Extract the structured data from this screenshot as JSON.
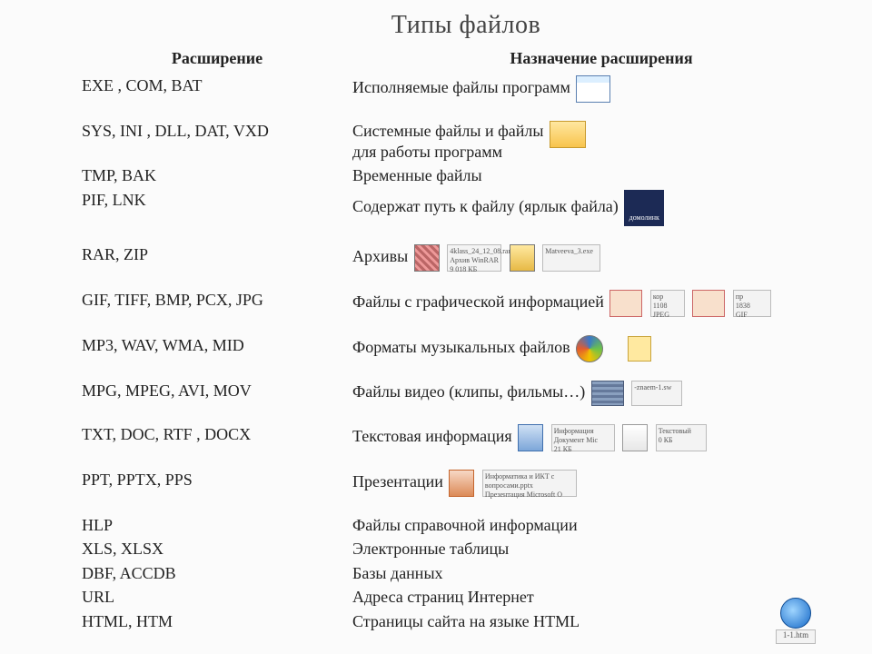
{
  "title": "Типы файлов",
  "headers": {
    "ext": "Расширение",
    "desc": "Назначение расширения"
  },
  "rows": [
    {
      "ext": "EXE ,  COM,     BAT",
      "desc": "Исполняемые файлы программ"
    },
    {
      "ext": "SYS,   INI ,   DLL, DAT, VXD",
      "desc": "Системные файлы и файлы\nдля работы программ"
    },
    {
      "ext": "TMP,    BAK",
      "desc": "Временные файлы"
    },
    {
      "ext": "PIF, LNK",
      "desc": "Содержат путь к файлу (ярлык файла)"
    },
    {
      "ext": "RAR,   ZIP",
      "desc": "Архивы"
    },
    {
      "ext": "GIF, TIFF,   BMP,   PCX,   JPG",
      "desc": "Файлы с графической информацией"
    },
    {
      "ext": "MP3,   WAV,  WMA,  MID",
      "desc": "Форматы музыкальных файлов"
    },
    {
      "ext": "MPG,   MPEG,   AVI, MOV",
      "desc": "Файлы видео (клипы, фильмы…)"
    },
    {
      "ext": "TXT,   DOC,  RTF ,  DOCX",
      "desc": "Текстовая информация"
    },
    {
      "ext": "PPT,   PPTX,   PPS",
      "desc": "Презентации"
    },
    {
      "ext": "HLP",
      "desc": "Файлы справочной информации"
    },
    {
      "ext": "XLS,  XLSX",
      "desc": "Электронные таблицы"
    },
    {
      "ext": "DBF, ACCDB",
      "desc": "Базы данных"
    },
    {
      "ext": "URL",
      "desc": "Адреса страниц Интернет"
    },
    {
      "ext": "HTML,  HTM",
      "desc": "Страницы сайта на языке HTML"
    }
  ],
  "thumb_labels": {
    "desklink": "домолинк",
    "rar": "4klass_24_12_08.rar\nАрхив WinRAR\n9 018 КБ",
    "zip": "Matveeva_3.exe",
    "img1": "кор\n1108\nJPEG",
    "img2": "пр\n1838\nGIF",
    "mov": "-znaem-1.sw",
    "doc": "Информация\nДокумент Mic\n21 КБ",
    "txt": "Текстовый\n0 КБ",
    "ppt": "Информатика и ИКТ с\nвопросами.pptx\nПрезентация Microsoft O",
    "ie": "1-1.htm"
  }
}
